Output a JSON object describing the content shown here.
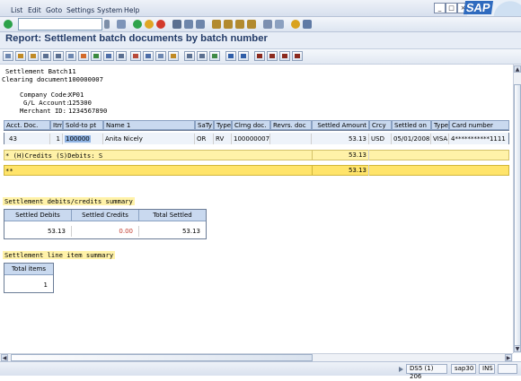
{
  "menubar": {
    "items": [
      "List",
      "Edit",
      "Goto",
      "Settings",
      "System",
      "Help"
    ],
    "window_controls": [
      "_",
      "□",
      "×"
    ],
    "brand": "SAP"
  },
  "title": "Report: Settlement batch documents by batch number",
  "header": {
    "settlement_batch_label": "Settlement Batch:",
    "settlement_batch_value": "11",
    "clearing_document_label": "Clearing document:",
    "clearing_document_value": "100000007",
    "company_code_label": "Company Code:",
    "company_code_value": "XP01",
    "gl_account_label": "G/L Account:",
    "gl_account_value": "125300",
    "merchant_id_label": "Merchant ID:",
    "merchant_id_value": "1234567890"
  },
  "table": {
    "columns": [
      "Acct. Doc.",
      "Itm",
      "Sold-to pt",
      "Name 1",
      "SaTy",
      "Type",
      "Clrng doc.",
      "Revrs. doc",
      "Settled Amount",
      "Crcy",
      "Settled on",
      "Type",
      "Card number"
    ],
    "row": [
      "43",
      "1",
      "100000",
      "Anita Nicely",
      "OR",
      "RV",
      "100000007",
      "",
      "53.13",
      "USD",
      "05/01/2008",
      "VISA",
      "4***********1111"
    ],
    "subtotal_label": "* (H)Credits (S)Debits: S",
    "subtotal_amount": "53.13",
    "total_label": "**",
    "total_amount": "53.13"
  },
  "summary": {
    "title": "Settlement debits/credits summary",
    "headers": [
      "Settled Debits",
      "Settled Credits",
      "Total Settled"
    ],
    "values": [
      "53.13",
      "0.00",
      "53.13"
    ]
  },
  "line_items": {
    "title": "Settlement line item summary",
    "header": "Total items",
    "value": "1"
  },
  "statusbar": {
    "session": "DS5 (1) 206",
    "server": "sap30",
    "mode": "INS"
  },
  "colors": {
    "title": "#243c68",
    "header_row": "#c9d9ef",
    "subtotal_row": "#fff2a8",
    "total_row": "#ffe46a",
    "credit_value": "#c0392b"
  }
}
